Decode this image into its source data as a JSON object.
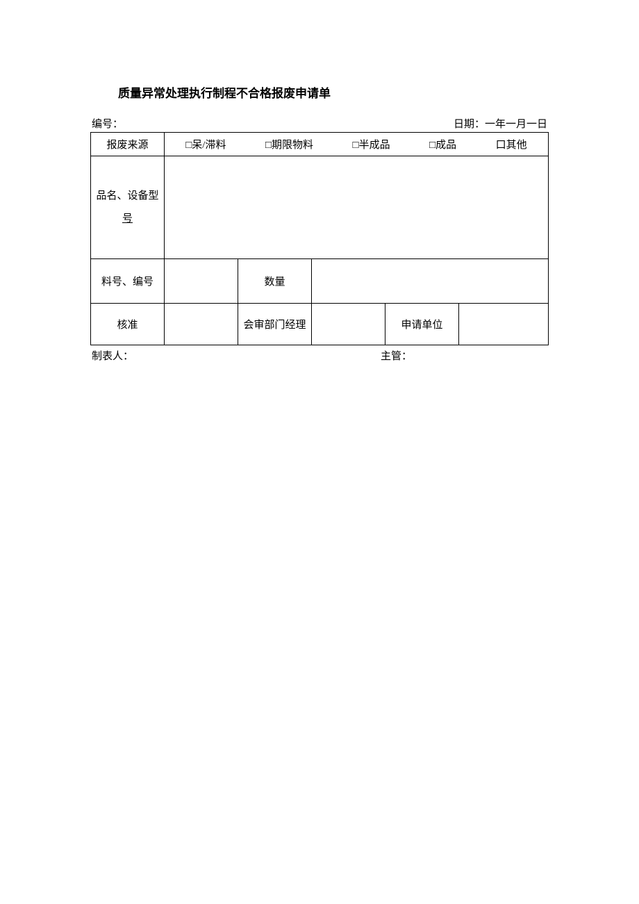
{
  "title": "质量异常处理执行制程不合格报废申请单",
  "header": {
    "serial_label": "编号：",
    "date_label": "日期：一年一月一日"
  },
  "row_source": {
    "label": "报废来源",
    "opt1": "□呆/滞料",
    "opt2": "□期限物料",
    "opt3": "□半成品",
    "opt4": "□成品",
    "opt5": "口其他"
  },
  "row_name": {
    "label_line1": "品名、设备型",
    "label_line2": "号"
  },
  "row_part": {
    "label": "料号、编号",
    "qty_label": "数量"
  },
  "row_approve": {
    "label": "核准",
    "dept_label": "会审部门经理",
    "unit_label": "申请单位"
  },
  "footer": {
    "preparer": "制表人：",
    "supervisor": "主管："
  }
}
